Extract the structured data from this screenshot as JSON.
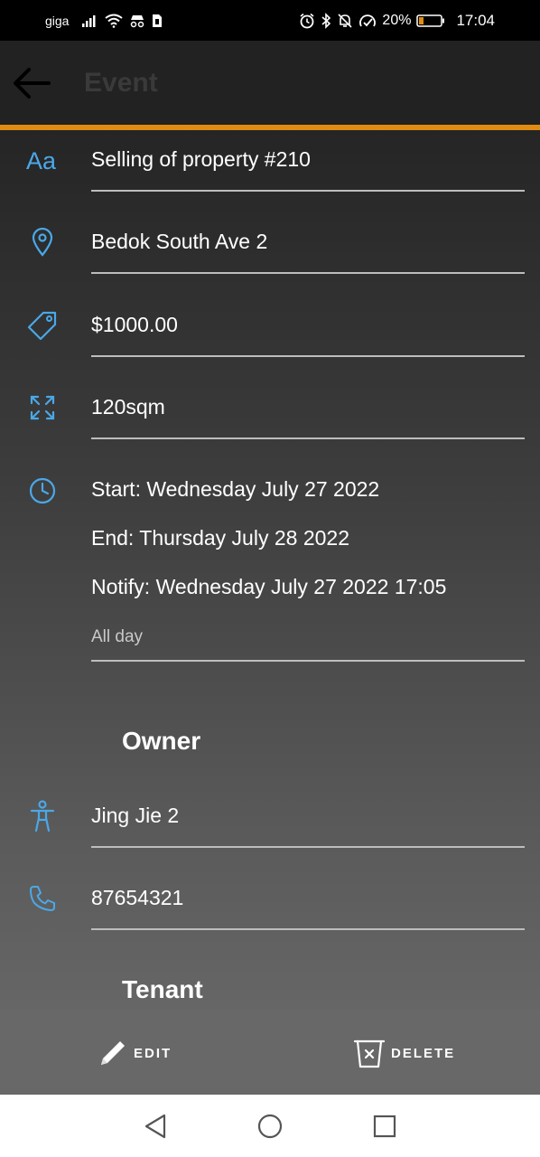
{
  "status_bar": {
    "carrier": "giga",
    "battery_percent": "20%",
    "time": "17:04",
    "icons": [
      "signal-icon",
      "wifi-icon",
      "incognito-icon",
      "sim-icon",
      "alarm-icon",
      "bluetooth-icon",
      "mute-icon",
      "data-saver-icon",
      "battery-icon"
    ]
  },
  "app_bar": {
    "title": "Event",
    "back_icon": "arrow-left-icon"
  },
  "event": {
    "title": "Selling of property #210",
    "location": "Bedok South Ave 2",
    "price": "$1000.00",
    "size": "120sqm",
    "start": "Start: Wednesday July 27 2022",
    "end": "End: Thursday July 28 2022",
    "notify": "Notify: Wednesday July 27 2022 17:05",
    "all_day": "All day"
  },
  "owner": {
    "section_title": "Owner",
    "name": "Jing Jie 2",
    "phone": "87654321"
  },
  "tenant": {
    "section_title": "Tenant"
  },
  "actions": {
    "edit_label": "EDIT",
    "delete_label": "DELETE"
  },
  "colors": {
    "accent": "#e08c12",
    "icon_blue": "#4aa8e8",
    "app_bar": "#222222",
    "action_bar": "#686868"
  }
}
